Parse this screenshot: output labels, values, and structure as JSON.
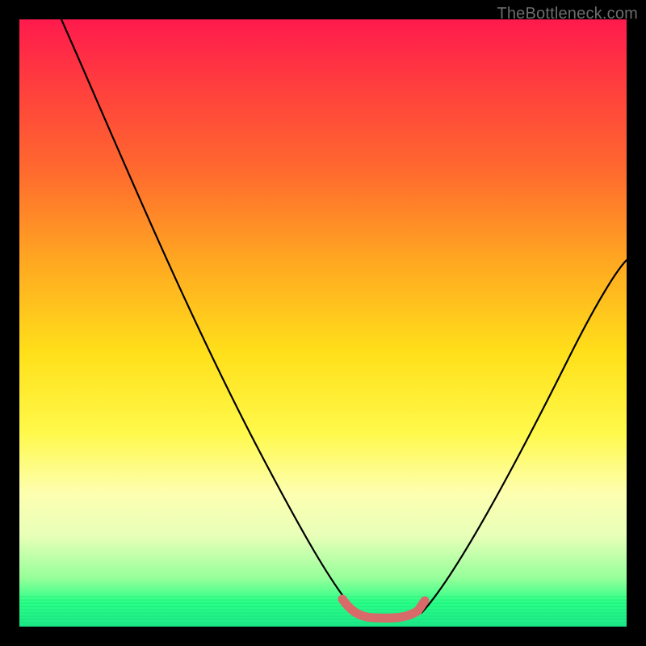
{
  "watermark": "TheBottleneck.com",
  "colors": {
    "frame": "#000000",
    "gradient_top": "#ff1a4d",
    "gradient_bottom": "#1de987",
    "curve": "#000000",
    "accent_stroke": "#d86a6a"
  },
  "chart_data": {
    "type": "line",
    "title": "",
    "xlabel": "",
    "ylabel": "",
    "xlim": [
      0,
      100
    ],
    "ylim": [
      0,
      100
    ],
    "grid": false,
    "series": [
      {
        "name": "left-curve",
        "color": "#000000",
        "x": [
          7,
          10,
          15,
          20,
          25,
          30,
          35,
          40,
          45,
          50,
          52,
          54,
          56
        ],
        "values": [
          100,
          94,
          84,
          73,
          62,
          50,
          38,
          27,
          16,
          6,
          3,
          1,
          0
        ]
      },
      {
        "name": "right-curve",
        "color": "#000000",
        "x": [
          66,
          68,
          70,
          74,
          78,
          82,
          86,
          90,
          94,
          98,
          100
        ],
        "values": [
          0,
          1,
          3,
          8,
          14,
          21,
          29,
          37,
          46,
          55,
          60
        ]
      },
      {
        "name": "trough-accent",
        "color": "#d86a6a",
        "x": [
          53,
          55,
          57,
          59,
          61,
          63,
          65,
          67
        ],
        "values": [
          3.5,
          2.2,
          1.6,
          1.5,
          1.5,
          1.7,
          2.4,
          3.8
        ]
      }
    ],
    "note": "Values are estimated from pixel positions; y increases upward, 0 at bottom of plot area."
  }
}
